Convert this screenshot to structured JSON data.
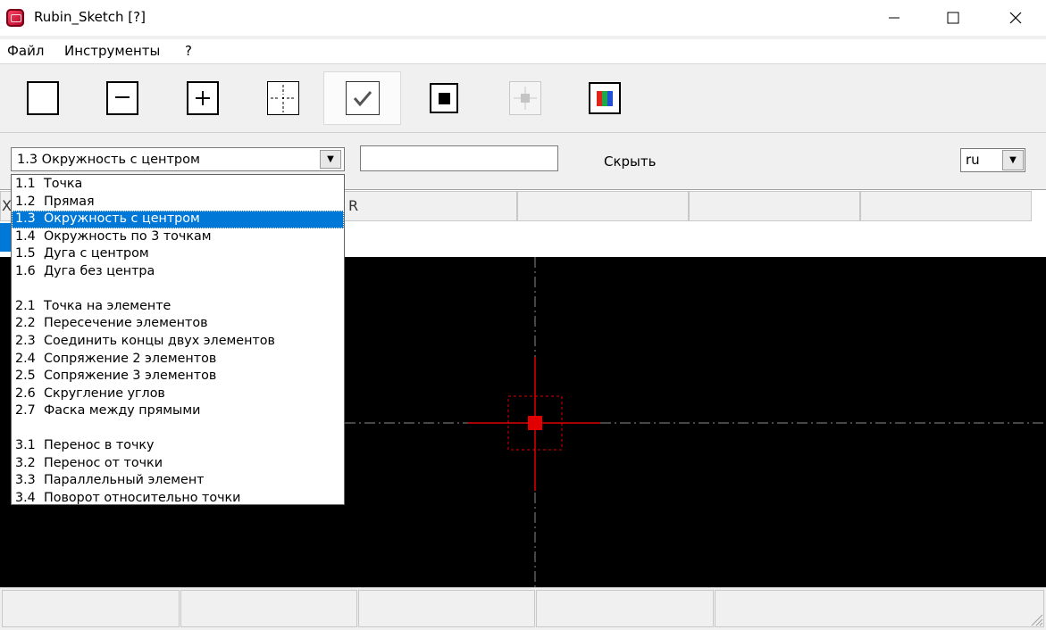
{
  "window": {
    "title": "Rubin_Sketch [?]",
    "min_icon": "minimize-icon",
    "max_icon": "maximize-icon",
    "close_icon": "close-icon"
  },
  "menu": {
    "items": [
      "Файл",
      "Инструменты",
      "?"
    ]
  },
  "toolbar": {
    "buttons": [
      {
        "icon": "empty-square-icon",
        "active": false
      },
      {
        "icon": "minus-square-icon",
        "active": false
      },
      {
        "icon": "plus-square-icon",
        "active": false
      },
      {
        "icon": "crosshair-icon",
        "active": false
      },
      {
        "icon": "checkmark-icon",
        "active": true
      },
      {
        "icon": "filled-square-icon",
        "active": false
      },
      {
        "icon": "point-disabled-icon",
        "active": false
      },
      {
        "icon": "color-bars-icon",
        "active": false
      }
    ]
  },
  "options": {
    "selected": "1.3  Окружность с центром",
    "param_value": "",
    "hide_label": "Скрыть",
    "lang": "ru"
  },
  "grid": {
    "col_x": "X",
    "col_r": "R"
  },
  "dropdown": {
    "options": [
      {
        "num": "1.1",
        "label": "Точка"
      },
      {
        "num": "1.2",
        "label": "Прямая"
      },
      {
        "num": "1.3",
        "label": "Окружность с центром",
        "selected": true
      },
      {
        "num": "1.4",
        "label": "Окружность по 3 точкам"
      },
      {
        "num": "1.5",
        "label": "Дуга с центром"
      },
      {
        "num": "1.6",
        "label": "Дуга без центра"
      },
      {
        "num": "",
        "label": ""
      },
      {
        "num": "2.1",
        "label": "Точка на элементе"
      },
      {
        "num": "2.2",
        "label": "Пересечение элементов"
      },
      {
        "num": "2.3",
        "label": "Соединить концы двух элементов"
      },
      {
        "num": "2.4",
        "label": "Сопряжение 2 элементов"
      },
      {
        "num": "2.5",
        "label": "Сопряжение 3 элементов"
      },
      {
        "num": "2.6",
        "label": "Скругление углов"
      },
      {
        "num": "2.7",
        "label": "Фаска между прямыми"
      },
      {
        "num": "",
        "label": ""
      },
      {
        "num": "3.1",
        "label": "Перенос в точку"
      },
      {
        "num": "3.2",
        "label": "Перенос от точки"
      },
      {
        "num": "3.3",
        "label": "Параллельный элемент"
      },
      {
        "num": "3.4",
        "label": "Поворот относительно точки"
      }
    ]
  },
  "colors": {
    "accent": "#0078d7",
    "canvas": "#000000",
    "cursor": "#ff0000",
    "axes": "#808080"
  }
}
